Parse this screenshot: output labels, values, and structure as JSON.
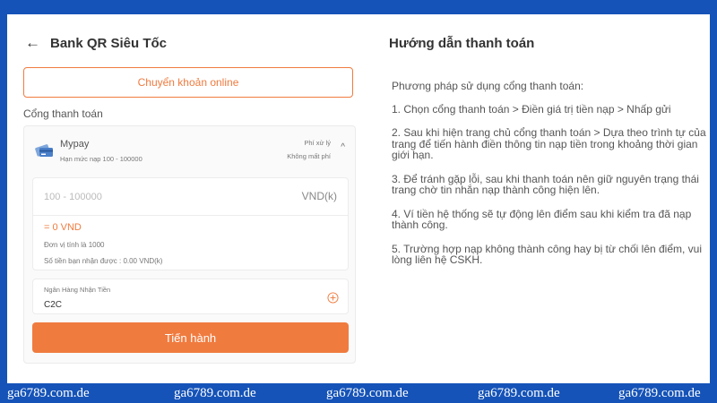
{
  "header": {
    "title": "Bank QR Siêu Tốc"
  },
  "online_button": "Chuyển khoản online",
  "gate_label": "Cổng thanh toán",
  "gateway": {
    "name": "Mypay",
    "limit": "Hạn mức nạp 100 - 100000",
    "fee_label": "Phí xử lý",
    "fee_value": "Không mất phí"
  },
  "amount": {
    "placeholder": "100 - 100000",
    "unit": "VND(k)",
    "converted": "= 0 VND",
    "unit_note": "Đơn vị tính là 1000",
    "received": "Số tiền bạn nhận được : 0.00 VND(k)"
  },
  "bank": {
    "label": "Ngân Hàng Nhận Tiền",
    "value": "C2C"
  },
  "submit_label": "Tiến hành",
  "guide": {
    "title": "Hướng dẫn thanh toán",
    "intro": "Phương pháp sử dụng cổng thanh toán:",
    "steps": [
      "1. Chọn cổng thanh toán > Điền giá trị tiền nạp > Nhấp gửi",
      "2. Sau khi hiện trang chủ cổng thanh toán > Dựa theo trình tự của trang để tiến hành điền thông tin nạp tiền trong khoảng thời gian giới hạn.",
      "3. Để tránh gặp lỗi, sau khi thanh toán nên giữ nguyên trạng thái trang chờ tin nhắn nạp thành công hiện lên.",
      "4. Ví tiền hệ thống sẽ tự động lên điểm sau khi kiểm tra đã nạp thành công.",
      "5. Trường hợp nạp không thành công hay bị từ chối lên điểm, vui lòng liên hệ CSKH."
    ]
  },
  "watermark": "ga6789.com.de",
  "colors": {
    "accent": "#f07b3f",
    "border_blue": "#1553b8"
  },
  "icons": {
    "back": "arrow-left-icon",
    "card": "card-icon",
    "collapse": "chevron-up-icon",
    "add": "plus-circle-icon"
  }
}
